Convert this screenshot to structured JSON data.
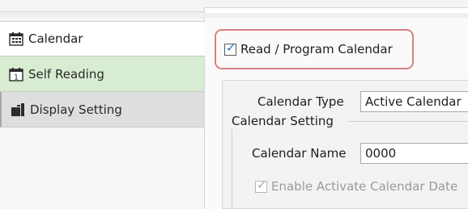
{
  "sidebar": {
    "items": [
      {
        "label": "Calendar",
        "icon": "calendar-grid-icon"
      },
      {
        "label": "Self Reading",
        "icon": "calendar-one-icon"
      },
      {
        "label": "Display Setting",
        "icon": "display-setting-icon"
      }
    ]
  },
  "main": {
    "read_program_checkbox": {
      "label": "Read / Program Calendar",
      "checked": true
    },
    "calendar_type": {
      "label": "Calendar Type",
      "value": "Active Calendar"
    },
    "calendar_setting": {
      "group_title": "Calendar Setting",
      "calendar_name_label": "Calendar Name",
      "calendar_name_value": "0000",
      "enable_activate_label": "Enable Activate Calendar Date",
      "enable_activate_checked": true
    }
  },
  "colors": {
    "selected_bg": "#ffffff",
    "self_reading_bg": "#d7ecd0",
    "display_setting_bg": "#dedede",
    "highlight_border": "#d98080",
    "check_accent": "#1e6fcc"
  }
}
